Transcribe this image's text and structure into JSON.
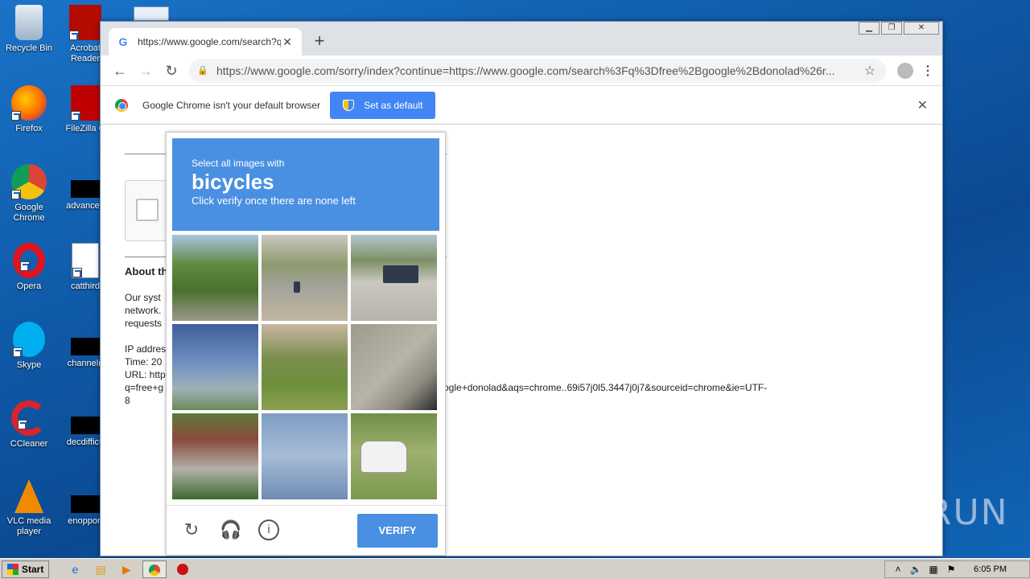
{
  "desktop": {
    "icons": [
      {
        "label": "Recycle Bin"
      },
      {
        "label": "Acrobat Reader"
      },
      {
        "label": "Firefox"
      },
      {
        "label": "FileZilla C"
      },
      {
        "label": "Google Chrome"
      },
      {
        "label": "advanced"
      },
      {
        "label": "Opera"
      },
      {
        "label": "catthird"
      },
      {
        "label": "Skype"
      },
      {
        "label": "channelri"
      },
      {
        "label": "CCleaner"
      },
      {
        "label": "decdifficu"
      },
      {
        "label": "VLC media player"
      },
      {
        "label": "enopport"
      }
    ]
  },
  "browser": {
    "tab_title": "https://www.google.com/search?q=",
    "new_tab": "+",
    "url": "https://www.google.com/sorry/index?continue=https://www.google.com/search%3Fq%3Dfree%2Bgoogle%2Bdonolad%26r...",
    "infobar": {
      "message": "Google Chrome isn't your default browser",
      "button": "Set as default"
    }
  },
  "page": {
    "about": "About th",
    "lines": [
      "Our syst",
      "network.",
      "requests"
    ],
    "ip_label": "IP addres",
    "time_label": "Time: 20",
    "url_label": "URL: http",
    "url_cont": "q=free+g",
    "url_end": "8",
    "url_tail": "ogle+donolad&aqs=chrome..69i57j0l5.3447j0j7&sourceid=chrome&ie=UTF-"
  },
  "captcha": {
    "instruction": "Select all images with",
    "target": "bicycles",
    "hint": "Click verify once there are none left",
    "verify": "VERIFY"
  },
  "watermark": "ANY RUN",
  "taskbar": {
    "start": "Start",
    "clock": "6:05 PM"
  }
}
